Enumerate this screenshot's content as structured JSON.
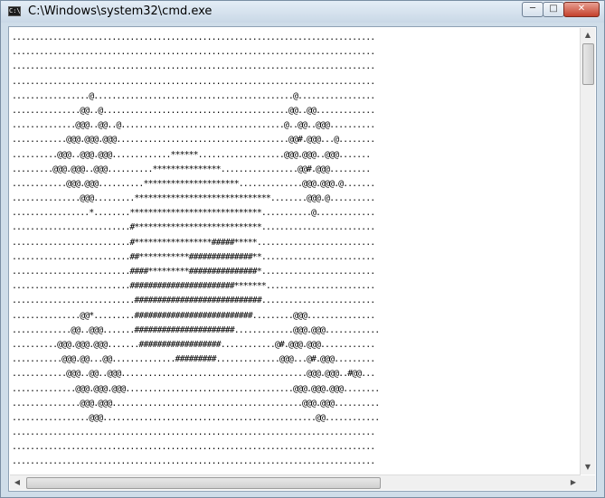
{
  "window": {
    "title": "C:\\Windows\\system32\\cmd.exe",
    "icon": "console-app-icon",
    "controls": {
      "minimize": "minimize-icon",
      "maximize": "maximize-icon",
      "close": "close-icon"
    }
  },
  "colors": {
    "titlebar": "#c9d8e6",
    "console_bg": "#ffffff",
    "console_text": "#000000",
    "close_button": "#c4402b"
  },
  "console": {
    "lines": [
      "................................................................................",
      "................................................................................",
      "................................................................................",
      "................................................................................",
      ".................@............................................@.................",
      "...............@@..@.........................................@@..@@.............",
      "..............@@@..@@..@....................................@..@@..@@@..........",
      "............@@@.@@@.@@@......................................@@#.@@@...@........",
      "..........@@@..@@@.@@@.............******...................@@@.@@@..@@@.......",
      ".........@@@.@@@..@@@..........***************.................@@#.@@@.........",
      "............@@@.@@@..........*********************..............@@@.@@@.@.......",
      "...............@@@.........******************************........@@@.@..........",
      ".................*........*****************************...........@.............",
      "..........................#****************************.........................",
      "..........................#*****************#####*****..........................",
      "..........................##***********##############**.........................",
      "..........................####*********###############*.........................",
      "..........................#######################*******........................",
      "...........................############################.........................",
      "...............@@*.........##########################.........@@@...............",
      ".............@@..@@@.......######################.............@@@.@@@............",
      "..........@@@.@@@.@@@.......##################............@#.@@@.@@@............",
      "...........@@@.@@...@@..............#########..............@@@...@#.@@@.........",
      "............@@@..@@..@@@.........................................@@@.@@@..#@@...",
      "..............@@@.@@@.@@@.....................................@@@.@@@.@@@........",
      "...............@@@.@@@..........................................@@@.@@@..........",
      ".................@@@...............................................@@............",
      "................................................................................",
      "................................................................................",
      "................................................................................"
    ]
  }
}
